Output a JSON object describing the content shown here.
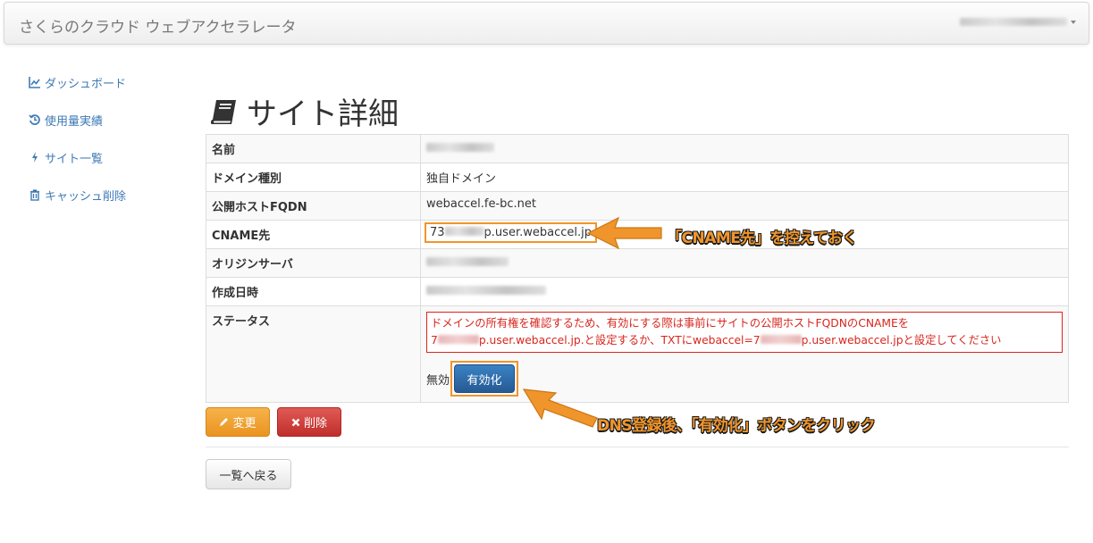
{
  "app": {
    "title": "さくらのクラウド ウェブアクセラレータ"
  },
  "sidebar": {
    "items": [
      {
        "label": "ダッシュボード",
        "icon": "line-chart-icon"
      },
      {
        "label": "使用量実績",
        "icon": "history-icon"
      },
      {
        "label": "サイト一覧",
        "icon": "bolt-icon"
      },
      {
        "label": "キャッシュ削除",
        "icon": "trash-icon"
      }
    ]
  },
  "page": {
    "title": "サイト詳細",
    "icon": "book-icon"
  },
  "details": {
    "name_label": "名前",
    "domain_type_label": "ドメイン種別",
    "domain_type_value": "独自ドメイン",
    "fqdn_label": "公開ホストFQDN",
    "fqdn_value": "webaccel.fe-bc.net",
    "cname_label": "CNAME先",
    "cname_prefix": "73",
    "cname_suffix": "p.user.webaccel.jp",
    "origin_label": "オリジンサーバ",
    "created_label": "作成日時",
    "status_label": "ステータス",
    "alert_line1": "ドメインの所有権を確認するため、有効にする際は事前にサイトの公開ホストFQDNのCNAMEを",
    "alert_line2_a": "7",
    "alert_line2_b": "p.user.webaccel.jp.と設定するか、TXTにwebaccel=7",
    "alert_line2_c": "p.user.webaccel.jpと設定してください",
    "status_value": "無効",
    "activate_label": "有効化"
  },
  "actions": {
    "edit_label": "変更",
    "delete_label": "削除",
    "back_label": "一覧へ戻る"
  },
  "annotations": {
    "cname_note": "「CNAME先」を控えておく",
    "activate_note": "DNS登録後、「有効化」ボタンをクリック"
  },
  "colors": {
    "accent_orange": "#f0952b",
    "link_blue": "#3f7ab5",
    "alert_red": "#d9251d"
  }
}
